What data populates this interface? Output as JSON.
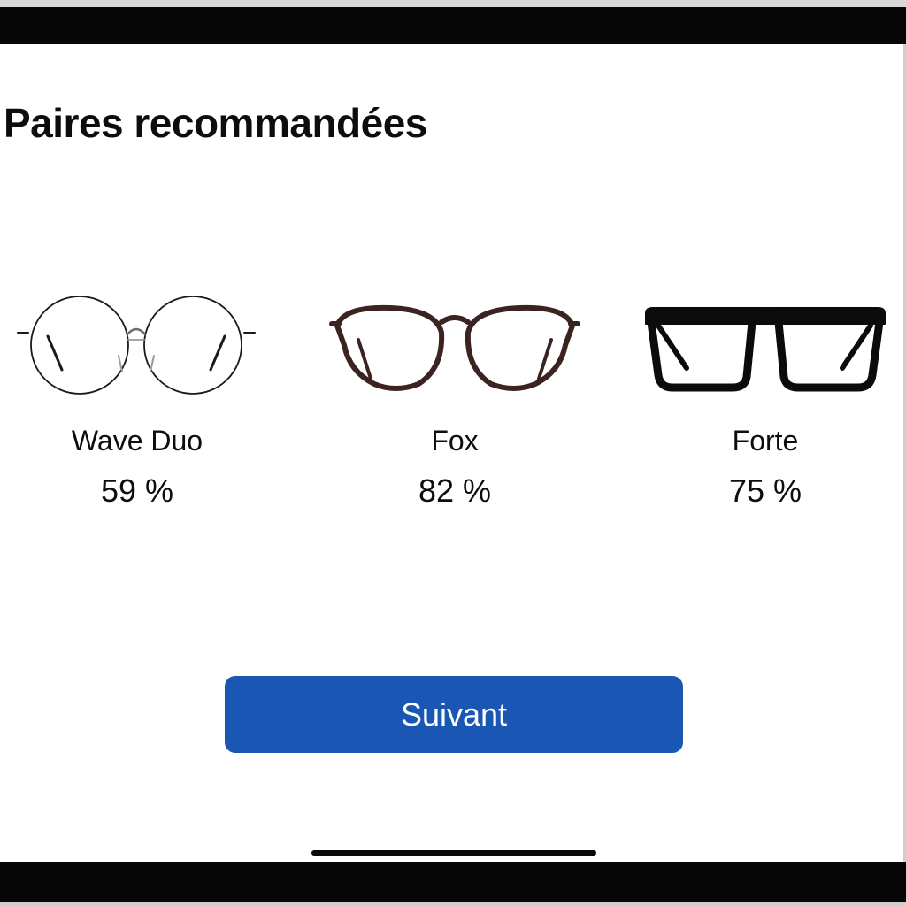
{
  "page": {
    "title": "Paires recommandées"
  },
  "products": [
    {
      "name": "Wave Duo",
      "score": "59 %",
      "icon": "round-wire-glasses-icon",
      "frame_color": "#1a1a1a"
    },
    {
      "name": "Fox",
      "score": "82 %",
      "icon": "round-acetate-glasses-icon",
      "frame_color": "#3a2320"
    },
    {
      "name": "Forte",
      "score": "75 %",
      "icon": "square-thick-glasses-icon",
      "frame_color": "#0b0b0b"
    }
  ],
  "actions": {
    "next_label": "Suivant"
  },
  "colors": {
    "accent": "#1a56b3",
    "bars": "#070707"
  }
}
